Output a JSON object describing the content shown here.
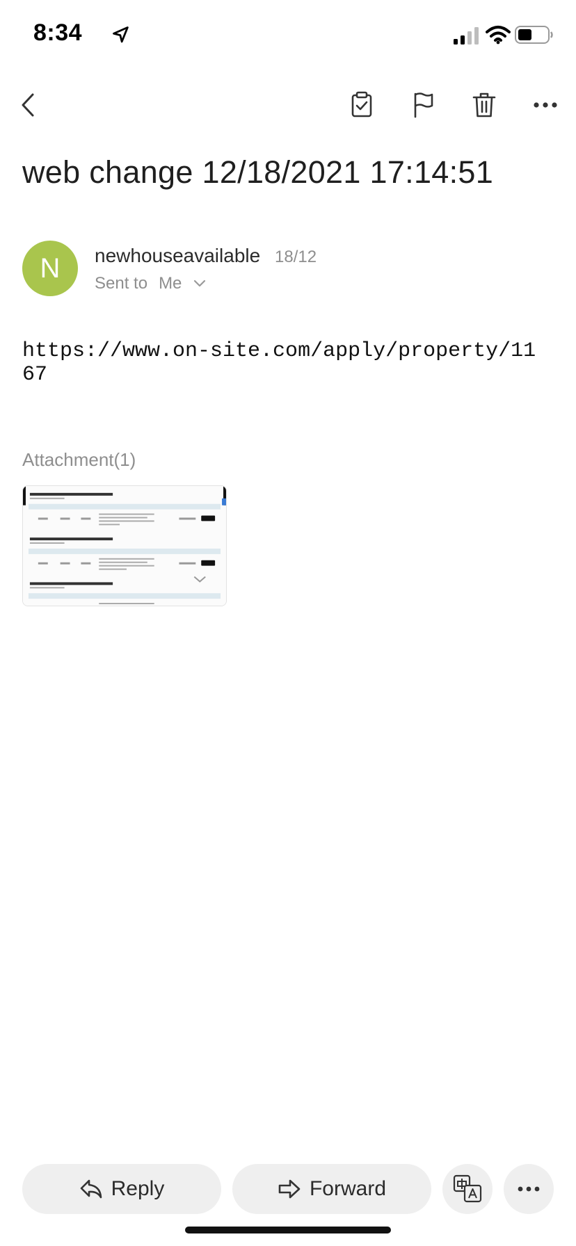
{
  "status_bar": {
    "time": "8:34",
    "icons": [
      "location-arrow-icon",
      "cellular-signal-icon",
      "wifi-icon",
      "battery-icon"
    ]
  },
  "toolbar": {
    "icons": [
      "back-chevron-icon",
      "mark-done-clipboard-icon",
      "flag-icon",
      "trash-icon",
      "more-horizontal-icon"
    ]
  },
  "email": {
    "subject": "web change 12/18/2021 17:14:51",
    "sender": {
      "initial": "N",
      "name": "newhouseavailable",
      "date": "18/12",
      "avatar_color": "#a9c54d"
    },
    "sent_to_label": "Sent to",
    "recipient": "Me",
    "body_url": "https://www.on-site.com/apply/property/1167",
    "attachment_label": "Attachment(1)"
  },
  "actions": {
    "reply_label": "Reply",
    "forward_label": "Forward",
    "icons": [
      "reply-icon",
      "forward-icon",
      "translate-icon",
      "more-horizontal-icon"
    ]
  },
  "colors": {
    "pill_bg": "#efefef",
    "muted_text": "#8e8e8e"
  }
}
